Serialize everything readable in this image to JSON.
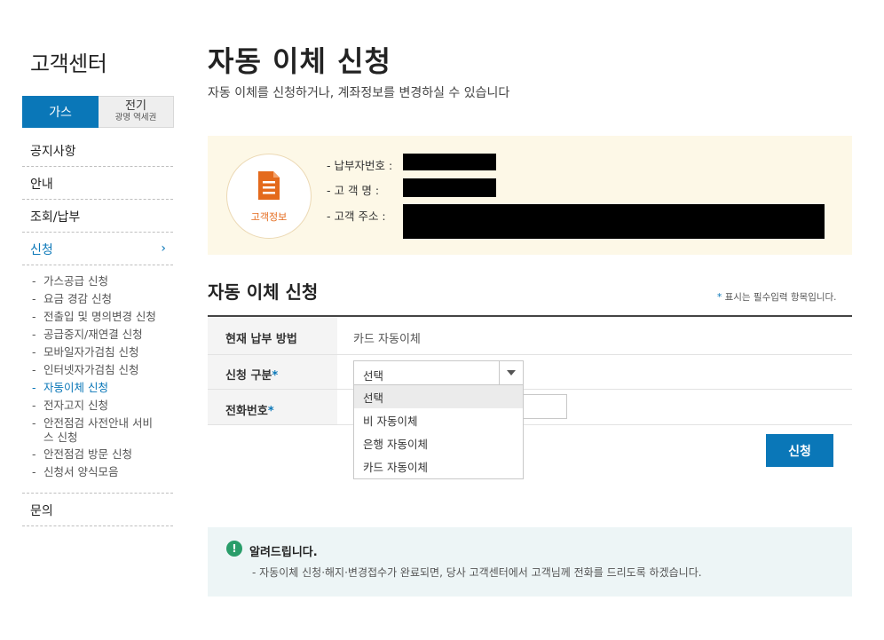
{
  "sidebar": {
    "title": "고객센터",
    "tabs": {
      "gas": "가스",
      "elec_main": "전기",
      "elec_sub": "광명 역세권"
    },
    "menu": [
      {
        "label": "공지사항"
      },
      {
        "label": "안내"
      },
      {
        "label": "조회/납부"
      },
      {
        "label": "신청",
        "active": true,
        "chevron": "›"
      }
    ],
    "submenu": [
      "가스공급 신청",
      "요금 경감 신청",
      "전출입 및 명의변경 신청",
      "공급중지/재연결 신청",
      "모바일자가검침 신청",
      "인터넷자가검침 신청",
      "자동이체 신청",
      "전자고지 신청",
      "안전점검 사전안내 서비스 신청",
      "안전점검 방문 신청",
      "신청서 양식모음"
    ],
    "submenu_dash": "-",
    "submenu_active_index": 6,
    "last_menu": "문의"
  },
  "page": {
    "title": "자동 이체 신청",
    "description": "자동 이체를 신청하거나, 계좌정보를 변경하실 수 있습니다"
  },
  "customer_info": {
    "badge_label": "고객정보",
    "icon": "document-icon",
    "rows": [
      {
        "label": "- 납부자번호 :"
      },
      {
        "label": "- 고   객   명 :"
      },
      {
        "label": "- 고객   주소 :"
      }
    ]
  },
  "form": {
    "section_title": "자동 이체 신청",
    "required_note_star": "*",
    "required_note": " 표시는 필수입력 항목입니다.",
    "rows": {
      "current_method": {
        "label": "현재 납부 방법",
        "value": "카드 자동이체"
      },
      "apply_type": {
        "label": "신청 구분",
        "star": "*",
        "selected": "선택"
      },
      "phone": {
        "label": "전화번호",
        "star": "*"
      }
    },
    "dropdown_options": [
      "선택",
      "비 자동이체",
      "은행 자동이체",
      "카드 자동이체"
    ],
    "submit_label": "신청"
  },
  "notice": {
    "icon": "exclamation-icon",
    "icon_glyph": "!",
    "title": "알려드립니다.",
    "body": "- 자동이체 신청·해지·변경접수가 완료되면, 당사 고객센터에서 고객님께 전화를 드리도록 하겠습니다."
  },
  "colors": {
    "primary": "#0a77b8",
    "info_bg": "#fdf8e7",
    "notice_bg": "#edf5f6",
    "badge_text": "#e46a1c"
  }
}
